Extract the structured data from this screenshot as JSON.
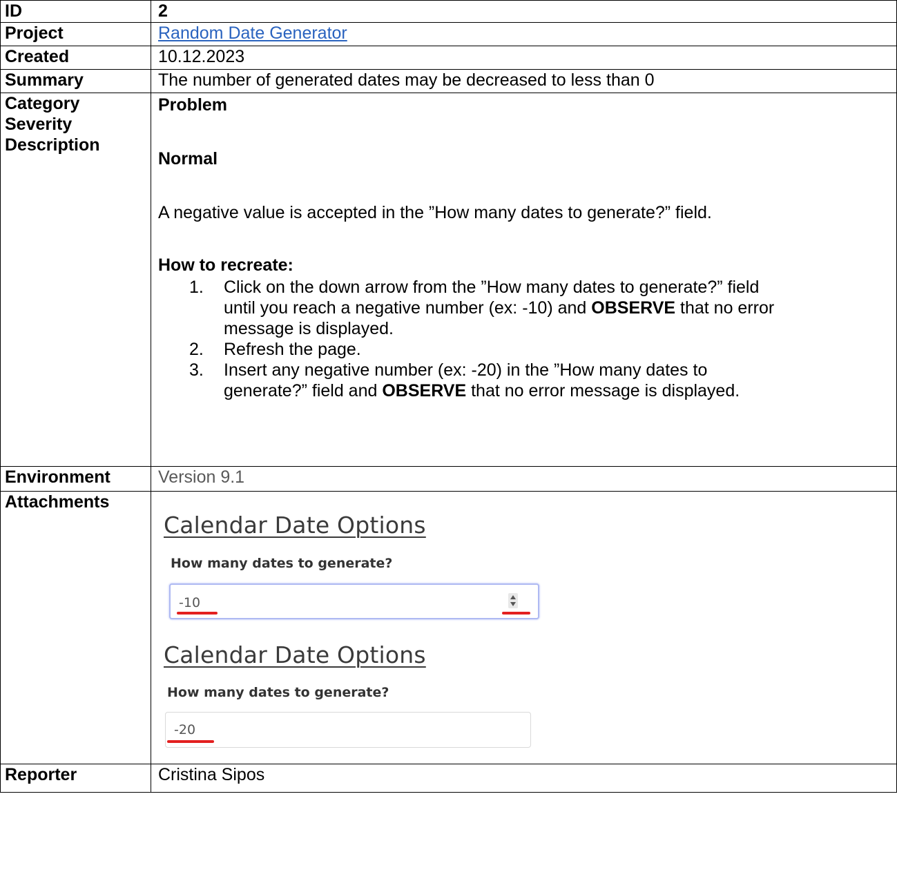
{
  "fields": {
    "id": {
      "label": "ID",
      "value": "2"
    },
    "project": {
      "label": "Project",
      "value": "Random Date Generator"
    },
    "created": {
      "label": "Created",
      "value": "10.12.2023"
    },
    "summary": {
      "label": "Summary",
      "value": "The number of generated dates may be decreased to less than 0"
    },
    "category": {
      "label": "Category",
      "value": "Problem"
    },
    "severity": {
      "label": "Severity",
      "value": "Normal"
    },
    "description": {
      "label": "Description",
      "intro": "A negative value is accepted in the ”How many dates to generate?” field.",
      "how_to_title": "How to recreate:",
      "steps": [
        {
          "num": "1.",
          "line1": "Click on the down arrow from the ”How many dates to generate?” field",
          "line2_pre": "until you reach a negative number (ex: -10) and ",
          "line2_bold": "OBSERVE",
          "line2_post": " that no error",
          "line3": "message is displayed."
        },
        {
          "num": "2.",
          "line1": "Refresh the page."
        },
        {
          "num": "3.",
          "line1": "Insert any negative number (ex: -20) in the ”How many dates to",
          "line2_pre": "generate?” field and ",
          "line2_bold": "OBSERVE",
          "line2_post": " that no error message is displayed."
        }
      ]
    },
    "environment": {
      "label": "Environment",
      "value": "Version 9.1"
    },
    "attachments": {
      "label": "Attachments",
      "shots": [
        {
          "title": "Calendar Date Options",
          "field_label": "How many dates to generate?",
          "value": "-10"
        },
        {
          "title": "Calendar Date Options",
          "field_label": "How many dates to generate?",
          "value": "-20"
        }
      ]
    },
    "reporter": {
      "label": "Reporter",
      "value": "Cristina Sipos"
    }
  },
  "colors": {
    "link": "#2a63bf",
    "annotation_red": "#e32020",
    "focus_border": "#aeb9f2"
  }
}
